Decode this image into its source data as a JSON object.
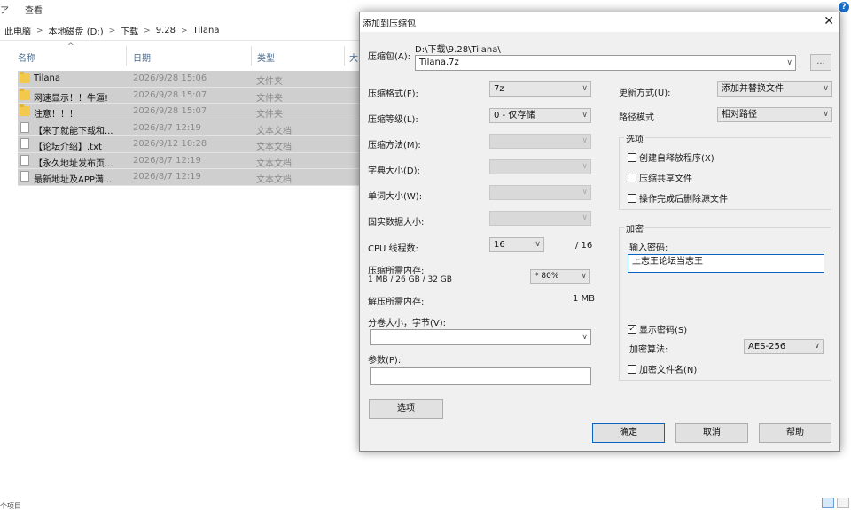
{
  "explorer": {
    "ribbon": {
      "partial_tab": "ア",
      "view_tab": "查看"
    },
    "breadcrumb": [
      "此电脑",
      "本地磁盘 (D:)",
      "下载",
      "9.28",
      "Tilana"
    ],
    "columns": {
      "name": "名称",
      "date": "日期",
      "type": "类型",
      "size": "大"
    },
    "files": [
      {
        "icon": "folder",
        "name": "Tilana",
        "date": "2026/9/28 15:06",
        "type": "文件夹"
      },
      {
        "icon": "folder",
        "name": "网速显示！！牛逼!",
        "date": "2026/9/28 15:07",
        "type": "文件夹"
      },
      {
        "icon": "folder",
        "name": "注意！！！",
        "date": "2026/9/28 15:07",
        "type": "文件夹"
      },
      {
        "icon": "doc",
        "name": "【来了就能下载和...",
        "date": "2026/8/7 12:19",
        "type": "文本文档"
      },
      {
        "icon": "doc",
        "name": "【论坛介绍】.txt",
        "date": "2026/9/12 10:28",
        "type": "文本文档"
      },
      {
        "icon": "doc",
        "name": "【永久地址发布页...",
        "date": "2026/8/7 12:19",
        "type": "文本文档"
      },
      {
        "icon": "doc",
        "name": "最新地址及APP满...",
        "date": "2026/8/7 12:19",
        "type": "文本文档"
      }
    ],
    "status_left": "个项目"
  },
  "dialog": {
    "title": "添加到压缩包",
    "archive_label": "压缩包(A):",
    "archive_path": "D:\\下载\\9.28\\Tilana\\",
    "archive_name": "Tilana.7z",
    "browse_label": "...",
    "format_label": "压缩格式(F):",
    "format_value": "7z",
    "level_label": "压缩等级(L):",
    "level_value": "0 - 仅存储",
    "method_label": "压缩方法(M):",
    "dict_label": "字典大小(D):",
    "word_label": "单词大小(W):",
    "solid_label": "固实数据大小:",
    "cpu_label": "CPU 线程数:",
    "cpu_value": "16",
    "cpu_total": "/ 16",
    "mem_compress_label": "压缩所需内存:",
    "mem_compress_detail": "1 MB / 26 GB / 32 GB",
    "mem_percent": "* 80%",
    "mem_decompress_label": "解压所需内存:",
    "mem_decompress_value": "1 MB",
    "split_label": "分卷大小，字节(V):",
    "split_value": "",
    "params_label": "参数(P):",
    "params_value": "",
    "options_button": "选项",
    "update_label": "更新方式(U):",
    "update_value": "添加并替换文件",
    "path_label": "路径模式",
    "path_value": "相对路径",
    "options_group": "选项",
    "option_sfx": "创建自释放程序(X)",
    "option_shared": "压缩共享文件",
    "option_delete": "操作完成后删除源文件",
    "encrypt_group": "加密",
    "password_label": "输入密码:",
    "password_value": "上志王论坛当志王",
    "show_password": "显示密码(S)",
    "encrypt_method_label": "加密算法:",
    "encrypt_method_value": "AES-256",
    "encrypt_names": "加密文件名(N)",
    "ok_button": "确定",
    "cancel_button": "取消",
    "help_button": "帮助"
  }
}
